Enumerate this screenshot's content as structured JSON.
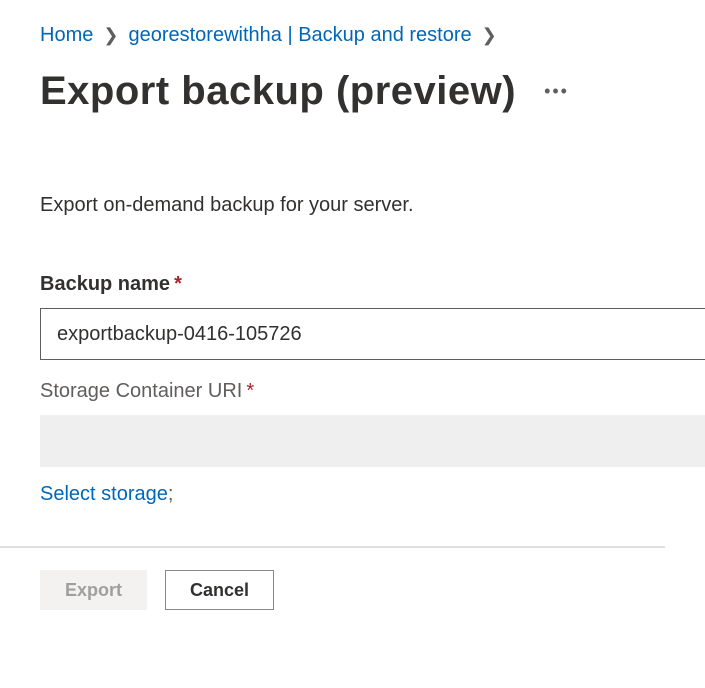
{
  "breadcrumb": {
    "home": "Home",
    "resource": "georestorewithha | Backup and restore"
  },
  "page": {
    "title": "Export backup (preview)",
    "description": "Export on-demand backup for your server."
  },
  "form": {
    "backup_name_label": "Backup name",
    "backup_name_value": "exportbackup-0416-105726",
    "storage_uri_label": "Storage Container URI",
    "storage_uri_value": "",
    "select_storage_link": "Select storage"
  },
  "footer": {
    "export_label": "Export",
    "cancel_label": "Cancel"
  }
}
